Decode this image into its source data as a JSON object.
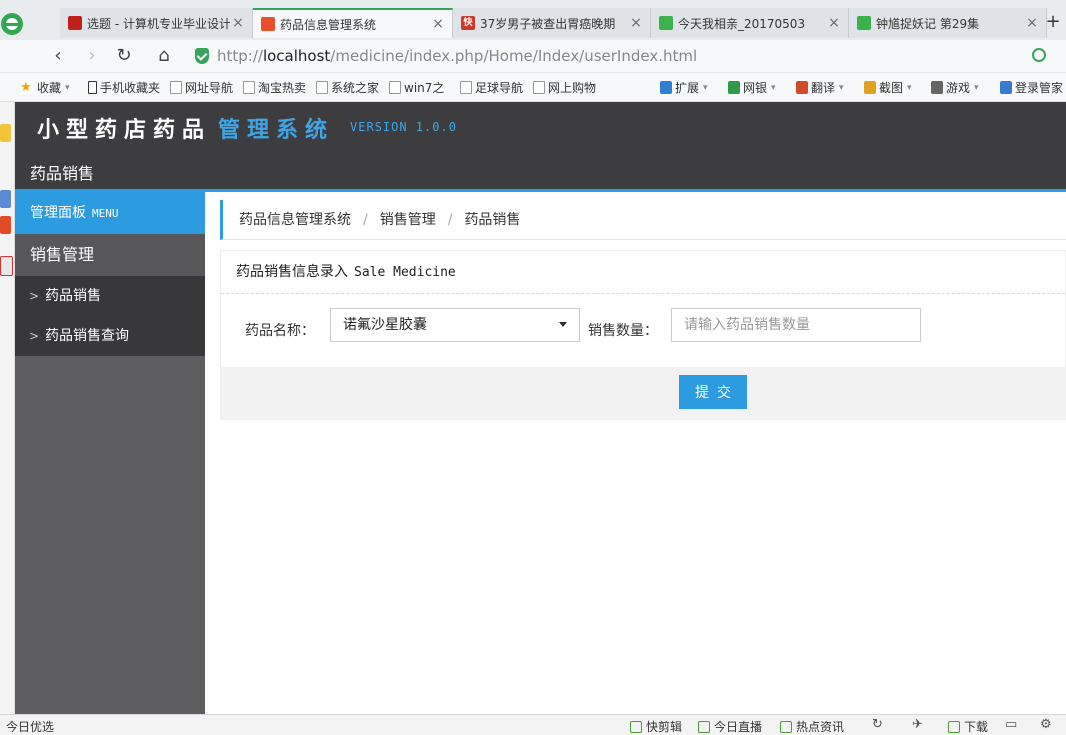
{
  "browser": {
    "tabs": [
      {
        "title": "选题 - 计算机专业毕业设计",
        "favicon_color": "#c0201a",
        "active": false
      },
      {
        "title": "药品信息管理系统",
        "favicon_color": "#e8502a",
        "active": true
      },
      {
        "title": "37岁男子被查出胃癌晚期",
        "favicon_color": "#d0382a",
        "favicon_text": "快",
        "active": false
      },
      {
        "title": "今天我相亲_20170503",
        "favicon_color": "#3ab34a",
        "favicon_text": "iQIYI",
        "active": false
      },
      {
        "title": "钟馗捉妖记 第29集",
        "favicon_color": "#3ab34a",
        "favicon_text": "iQIYI",
        "active": false
      }
    ],
    "tab_close": "×",
    "new_tab": "+",
    "url": {
      "prefix": "http://",
      "host": "localhost",
      "path": "/medicine/index.php/Home/Index/userIndex.html"
    },
    "nav": {
      "back": "‹",
      "forward": "›",
      "reload": "↻",
      "home": "⌂"
    },
    "bookmarks_left": [
      {
        "label": "收藏",
        "icon": "star-icon",
        "caret": true
      },
      {
        "label": "手机收藏夹",
        "icon": "phone-icon"
      },
      {
        "label": "网址导航",
        "icon": "page-icon"
      },
      {
        "label": "淘宝热卖",
        "icon": "page-icon"
      },
      {
        "label": "系统之家",
        "icon": "page-icon"
      },
      {
        "label": "win7之",
        "icon": "page-icon"
      },
      {
        "label": "足球导航",
        "icon": "page-icon"
      },
      {
        "label": "网上购物",
        "icon": "page-icon"
      }
    ],
    "bookmarks_right": [
      {
        "label": "扩展",
        "color": "#2d7fd0"
      },
      {
        "label": "网银",
        "color": "#2e9a4a"
      },
      {
        "label": "翻译",
        "color": "#d04a2a"
      },
      {
        "label": "截图",
        "color": "#e0a020"
      },
      {
        "label": "游戏",
        "color": "#666666"
      },
      {
        "label": "登录管家",
        "color": "#3a7ad0"
      }
    ],
    "status_left": "今日优选",
    "status_items": [
      "快剪辑",
      "今日直播",
      "热点资讯",
      "下载"
    ]
  },
  "app": {
    "title_a": "小型药店药品",
    "title_b": "管理系统",
    "version": "VERSION 1.0.0",
    "module": "药品销售",
    "accent_color": "#2d9be0"
  },
  "sidebar": {
    "panel": {
      "label": "管理面板",
      "en": "MENU"
    },
    "group": "销售管理",
    "items": [
      {
        "label": "药品销售"
      },
      {
        "label": "药品销售查询"
      }
    ]
  },
  "breadcrumb": [
    "药品信息管理系统",
    "销售管理",
    "药品销售"
  ],
  "form": {
    "title": "药品销售信息录入",
    "title_en": "Sale Medicine",
    "name_label": "药品名称：",
    "name_value": "诺氟沙星胶囊",
    "qty_label": "销售数量：",
    "qty_placeholder": "请输入药品销售数量",
    "qty_value": "",
    "submit": "提交"
  }
}
